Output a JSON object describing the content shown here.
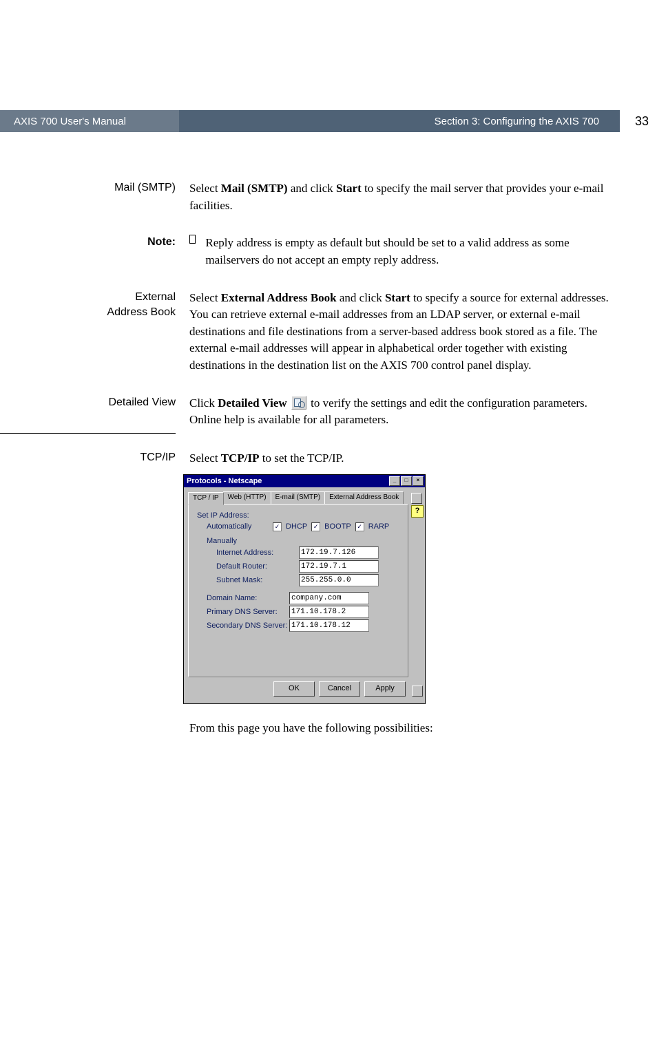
{
  "header": {
    "left": "AXIS 700 User's Manual",
    "right": "Section 3: Configuring the AXIS 700",
    "page_number": "33"
  },
  "sections": {
    "mail": {
      "label": "Mail (SMTP)",
      "body_pre": "Select ",
      "body_bold": "Mail (SMTP)",
      "body_mid": " and click ",
      "body_bold2": "Start",
      "body_post": " to specify the mail server that provides your e-mail facilities."
    },
    "note": {
      "label": "Note:",
      "bullet_text": "Reply address is empty as default but should be set to a valid address as some mailservers do not accept an empty reply address."
    },
    "external": {
      "label_line1": "External",
      "label_line2": "Address Book",
      "body_pre": "Select ",
      "body_bold": "External Address Book",
      "body_mid": " and click ",
      "body_bold2": "Start",
      "body_post": " to specify a source for external addresses. You can retrieve external e-mail addresses from an LDAP server, or external e-mail destinations and file destinations from a server-based address book stored as a file. The external e-mail addresses will appear in alphabetical order together with existing destinations in the destination list on the AXIS 700 control panel display."
    },
    "detailed": {
      "label": "Detailed View",
      "body_pre": "Click ",
      "body_bold": "Detailed View",
      "body_post": " to verify the settings and edit the configuration parameters. Online help is available for all parameters."
    },
    "tcpip": {
      "label": "TCP/IP",
      "body_pre": "Select ",
      "body_bold": "TCP/IP",
      "body_post": " to set the TCP/IP."
    }
  },
  "window": {
    "title": "Protocols - Netscape",
    "title_buttons": {
      "min": "_",
      "max": "□",
      "close": "×"
    },
    "help": "?",
    "tabs": [
      "TCP / IP",
      "Web (HTTP)",
      "E-mail (SMTP)",
      "External Address Book"
    ],
    "set_ip_label": "Set IP Address:",
    "auto_label": "Automatically",
    "checkboxes": {
      "dhcp": "DHCP",
      "bootp": "BOOTP",
      "rarp": "RARP"
    },
    "manually_label": "Manually",
    "fields": {
      "internet_addr": {
        "label": "Internet Address:",
        "value": "172.19.7.126"
      },
      "default_router": {
        "label": "Default Router:",
        "value": "172.19.7.1"
      },
      "subnet_mask": {
        "label": "Subnet Mask:",
        "value": "255.255.0.0"
      },
      "domain_name": {
        "label": "Domain Name:",
        "value": "company.com"
      },
      "primary_dns": {
        "label": "Primary DNS Server:",
        "value": "171.10.178.2"
      },
      "secondary_dns": {
        "label": "Secondary DNS Server:",
        "value": "171.10.178.12"
      }
    },
    "buttons": {
      "ok": "OK",
      "cancel": "Cancel",
      "apply": "Apply"
    }
  },
  "followup": "From this page you have the following possibilities:"
}
